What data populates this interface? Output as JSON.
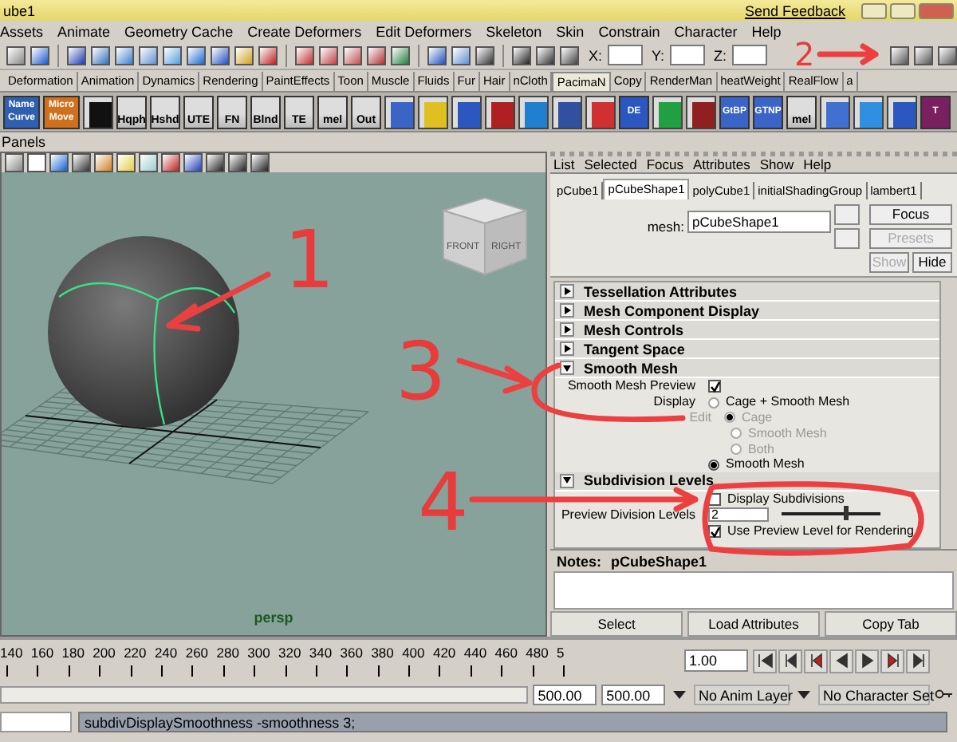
{
  "window": {
    "title": "ube1",
    "feedback_link": "Send Feedback"
  },
  "menu": [
    "Assets",
    "Animate",
    "Geometry Cache",
    "Create Deformers",
    "Edit Deformers",
    "Skeleton",
    "Skin",
    "Constrain",
    "Character",
    "Help"
  ],
  "status_line": {
    "x_label": "X:",
    "y_label": "Y:",
    "z_label": "Z:"
  },
  "shelf_tabs": [
    {
      "label": "Deformation",
      "selected": false
    },
    {
      "label": "Animation",
      "selected": false
    },
    {
      "label": "Dynamics",
      "selected": false
    },
    {
      "label": "Rendering",
      "selected": false
    },
    {
      "label": "PaintEffects",
      "selected": false
    },
    {
      "label": "Toon",
      "selected": false
    },
    {
      "label": "Muscle",
      "selected": false
    },
    {
      "label": "Fluids",
      "selected": false
    },
    {
      "label": "Fur",
      "selected": false
    },
    {
      "label": "Hair",
      "selected": false
    },
    {
      "label": "nCloth",
      "selected": false
    },
    {
      "label": "PacimaN",
      "selected": true
    },
    {
      "label": "Copy",
      "selected": false
    },
    {
      "label": "RenderMan",
      "selected": false
    },
    {
      "label": "heatWeight",
      "selected": false
    },
    {
      "label": "RealFlow",
      "selected": false
    },
    {
      "label": "a",
      "selected": false
    }
  ],
  "shelf_buttons": [
    {
      "kind": "tile",
      "label": "Name Curve",
      "color": "#2f5fb0"
    },
    {
      "kind": "tile",
      "label": "Micro Move",
      "color": "#d0701c"
    },
    {
      "kind": "glyph",
      "color": "#111111"
    },
    {
      "kind": "label",
      "label": "Hqph"
    },
    {
      "kind": "label",
      "label": "Hshd"
    },
    {
      "kind": "label",
      "label": "UTE"
    },
    {
      "kind": "label",
      "label": "FN"
    },
    {
      "kind": "label",
      "label": "Blnd"
    },
    {
      "kind": "label",
      "label": "TE"
    },
    {
      "kind": "label",
      "label": "mel"
    },
    {
      "kind": "label",
      "label": "Out"
    },
    {
      "kind": "glyph",
      "color": "#3a64c8"
    },
    {
      "kind": "glyph",
      "color": "#e0c020"
    },
    {
      "kind": "glyph",
      "color": "#2a58c0"
    },
    {
      "kind": "glyph",
      "color": "#b02020"
    },
    {
      "kind": "glyph",
      "color": "#2080d0"
    },
    {
      "kind": "glyph",
      "color": "#3050a0"
    },
    {
      "kind": "glyph",
      "color": "#d03030"
    },
    {
      "kind": "tile",
      "label": "DE",
      "color": "#2a58c0"
    },
    {
      "kind": "glyph",
      "color": "#20a040"
    },
    {
      "kind": "glyph",
      "color": "#902020"
    },
    {
      "kind": "tile",
      "label": "GtBP",
      "color": "#3a64c8"
    },
    {
      "kind": "tile",
      "label": "GTNP",
      "color": "#3a64c8"
    },
    {
      "kind": "label",
      "label": "mel"
    },
    {
      "kind": "glyph",
      "color": "#4070d0"
    },
    {
      "kind": "glyph",
      "color": "#3090e0"
    },
    {
      "kind": "glyph",
      "color": "#2a58c0"
    },
    {
      "kind": "tile",
      "label": "T",
      "color": "#7a2060"
    }
  ],
  "viewport": {
    "panels_menu": "Panels",
    "cube_faces": [
      "FRONT",
      "RIGHT"
    ],
    "camera": "persp"
  },
  "attribute_editor": {
    "menu": [
      "List",
      "Selected",
      "Focus",
      "Attributes",
      "Show",
      "Help"
    ],
    "tabs": [
      {
        "label": "pCube1",
        "selected": false
      },
      {
        "label": "pCubeShape1",
        "selected": true
      },
      {
        "label": "polyCube1",
        "selected": false
      },
      {
        "label": "initialShadingGroup",
        "selected": false
      },
      {
        "label": "lambert1",
        "selected": false
      }
    ],
    "node_label": "mesh:",
    "node_name": "pCubeShape1",
    "buttons": [
      {
        "label": "Focus",
        "disabled": false
      },
      {
        "label": "Presets",
        "disabled": true
      },
      {
        "label": "Show",
        "disabled": true
      },
      {
        "label": "Hide",
        "disabled": false
      }
    ],
    "sections": [
      {
        "title": "Tessellation Attributes",
        "expanded": false
      },
      {
        "title": "Mesh Component Display",
        "expanded": false
      },
      {
        "title": "Mesh Controls",
        "expanded": false
      },
      {
        "title": "Tangent Space",
        "expanded": false
      },
      {
        "title": "Smooth Mesh",
        "expanded": true,
        "rows": [
          {
            "kind": "checkbox",
            "label": "Smooth Mesh Preview",
            "checked": true
          },
          {
            "kind": "radio",
            "label": "Display",
            "option": "Cage + Smooth Mesh",
            "selected": false,
            "disabled": false
          },
          {
            "kind": "radio",
            "label": "Edit",
            "option": "Cage",
            "selected": true,
            "disabled": true
          },
          {
            "kind": "radio",
            "option": "Smooth Mesh",
            "selected": false,
            "disabled": true
          },
          {
            "kind": "radio",
            "option": "Both",
            "selected": false,
            "disabled": true
          },
          {
            "kind": "radio",
            "option": "Smooth Mesh",
            "selected": true,
            "disabled": false
          }
        ]
      },
      {
        "title": "Subdivision Levels",
        "expanded": true,
        "rows": [
          {
            "kind": "checkbox",
            "option": "Display Subdivisions",
            "checked": false
          },
          {
            "kind": "slider",
            "label": "Preview Division Levels",
            "value": "2",
            "level": 0.65
          },
          {
            "kind": "checkbox",
            "option": "Use Preview Level for Rendering",
            "checked": true
          }
        ]
      }
    ],
    "notes_label": "Notes:",
    "notes_node": "pCubeShape1",
    "bottom_buttons": [
      "Select",
      "Load Attributes",
      "Copy Tab"
    ]
  },
  "timeline": {
    "ticks": [
      "140",
      "160",
      "180",
      "200",
      "220",
      "240",
      "260",
      "280",
      "300",
      "320",
      "340",
      "360",
      "380",
      "400",
      "420",
      "440",
      "460",
      "480",
      "5"
    ],
    "current_frame": "1.00"
  },
  "range": {
    "start": "500.00",
    "end": "500.00",
    "anim_layer": "No Anim Layer",
    "character_set": "No Character Set"
  },
  "command_line": {
    "output": "subdivDisplaySmoothness -smoothness 3;"
  },
  "annotations": [
    {
      "label": "1"
    },
    {
      "label": "2"
    },
    {
      "label": "3"
    },
    {
      "label": "4"
    }
  ]
}
